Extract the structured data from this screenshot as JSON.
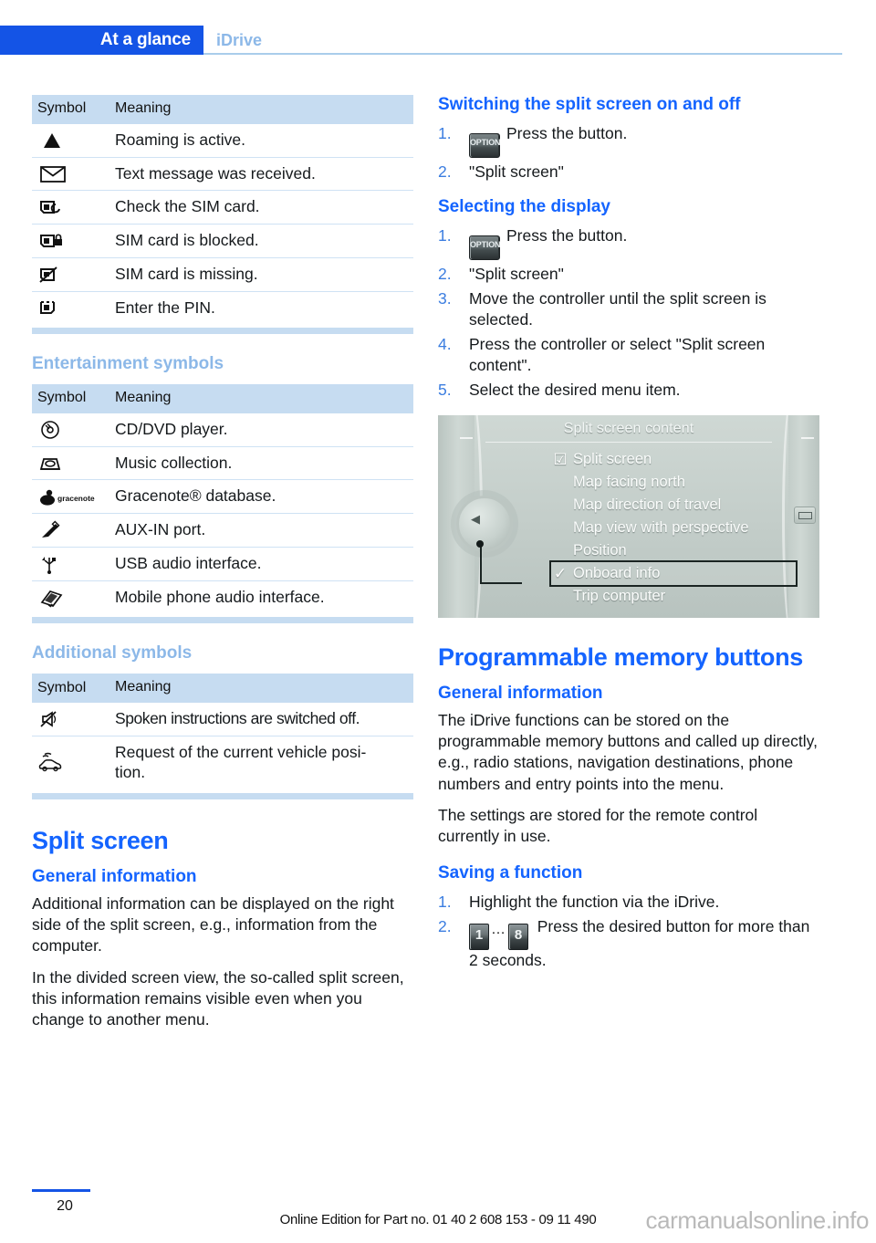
{
  "header": {
    "active_tab": "At a glance",
    "sub_tab": "iDrive"
  },
  "left_column": {
    "table1": {
      "columns": [
        "Symbol",
        "Meaning"
      ],
      "rows": [
        {
          "icon": "roaming-triangle-icon",
          "meaning": "Roaming is active."
        },
        {
          "icon": "envelope-icon",
          "meaning": "Text message was received."
        },
        {
          "icon": "sim-check-icon",
          "meaning": "Check the SIM card."
        },
        {
          "icon": "sim-locked-icon",
          "meaning": "SIM card is blocked."
        },
        {
          "icon": "sim-missing-icon",
          "meaning": "SIM card is missing."
        },
        {
          "icon": "sim-pin-icon",
          "meaning": "Enter the PIN."
        }
      ]
    },
    "entertainment_heading": "Entertainment symbols",
    "table2": {
      "columns": [
        "Symbol",
        "Meaning"
      ],
      "rows": [
        {
          "icon": "cd-dvd-icon",
          "meaning": "CD/DVD player."
        },
        {
          "icon": "music-collection-icon",
          "meaning": "Music collection."
        },
        {
          "icon": "gracenote-icon",
          "icon_label": "gracenote",
          "meaning": "Gracenote® database."
        },
        {
          "icon": "aux-in-plug-icon",
          "meaning": "AUX-IN port."
        },
        {
          "icon": "usb-icon",
          "meaning": "USB audio interface."
        },
        {
          "icon": "mobile-phone-audio-icon",
          "meaning": "Mobile phone audio interface."
        }
      ]
    },
    "additional_heading": "Additional symbols",
    "table3": {
      "columns": [
        "Symbol",
        "Meaning"
      ],
      "rows": [
        {
          "icon": "speaker-muted-icon",
          "meaning": "Spoken instructions are switched off."
        },
        {
          "icon": "vehicle-position-icon",
          "meaning": "Request of the current vehicle posi-\ntion."
        }
      ]
    },
    "split_screen_heading": "Split screen",
    "general_information_heading": "General information",
    "general_information_p1": "Additional information can be displayed on the right side of the split screen, e.g., information from the computer.",
    "general_information_p2": "In the divided screen view, the so-called split screen, this information remains visible even when you change to another menu."
  },
  "right_column": {
    "switching_heading": "Switching the split screen on and off",
    "switching_steps": [
      {
        "button": "OPTION",
        "text": "Press the button."
      },
      {
        "text": "\"Split screen\""
      }
    ],
    "selecting_heading": "Selecting the display",
    "selecting_steps": [
      {
        "button": "OPTION",
        "text": "Press the button."
      },
      {
        "text": "\"Split screen\""
      },
      {
        "text": "Move the controller until the split screen is selected."
      },
      {
        "text": "Press the controller or select \"Split screen content\"."
      },
      {
        "text": "Select the desired menu item."
      }
    ],
    "figure": {
      "title": "Split screen content",
      "items": [
        {
          "label": "Split screen",
          "mark": "checkbox",
          "selected": false
        },
        {
          "label": "Map facing north",
          "mark": "none",
          "selected": false
        },
        {
          "label": "Map direction of travel",
          "mark": "none",
          "selected": false
        },
        {
          "label": "Map view with perspective",
          "mark": "none",
          "selected": false
        },
        {
          "label": "Position",
          "mark": "none",
          "selected": false
        },
        {
          "label": "Onboard info",
          "mark": "check",
          "selected": true
        },
        {
          "label": "Trip computer",
          "mark": "none",
          "selected": false
        }
      ]
    },
    "memory_heading": "Programmable memory buttons",
    "memory_general_heading": "General information",
    "memory_p1": "The iDrive functions can be stored on the programmable memory buttons and called up directly, e.g., radio stations, navigation destinations, phone numbers and entry points into the menu.",
    "memory_p2": "The settings are stored for the remote control currently in use.",
    "saving_heading": "Saving a function",
    "saving_steps": [
      {
        "text": "Highlight the function via the iDrive."
      },
      {
        "buttons": [
          "1",
          "8"
        ],
        "dots": "…",
        "text": "Press the desired button for more than 2 seconds."
      }
    ]
  },
  "footer": {
    "page_number": "20",
    "note": "Online Edition for Part no. 01 40 2 608 153 - 09 11 490",
    "watermark": "carmanualsonline.info"
  }
}
